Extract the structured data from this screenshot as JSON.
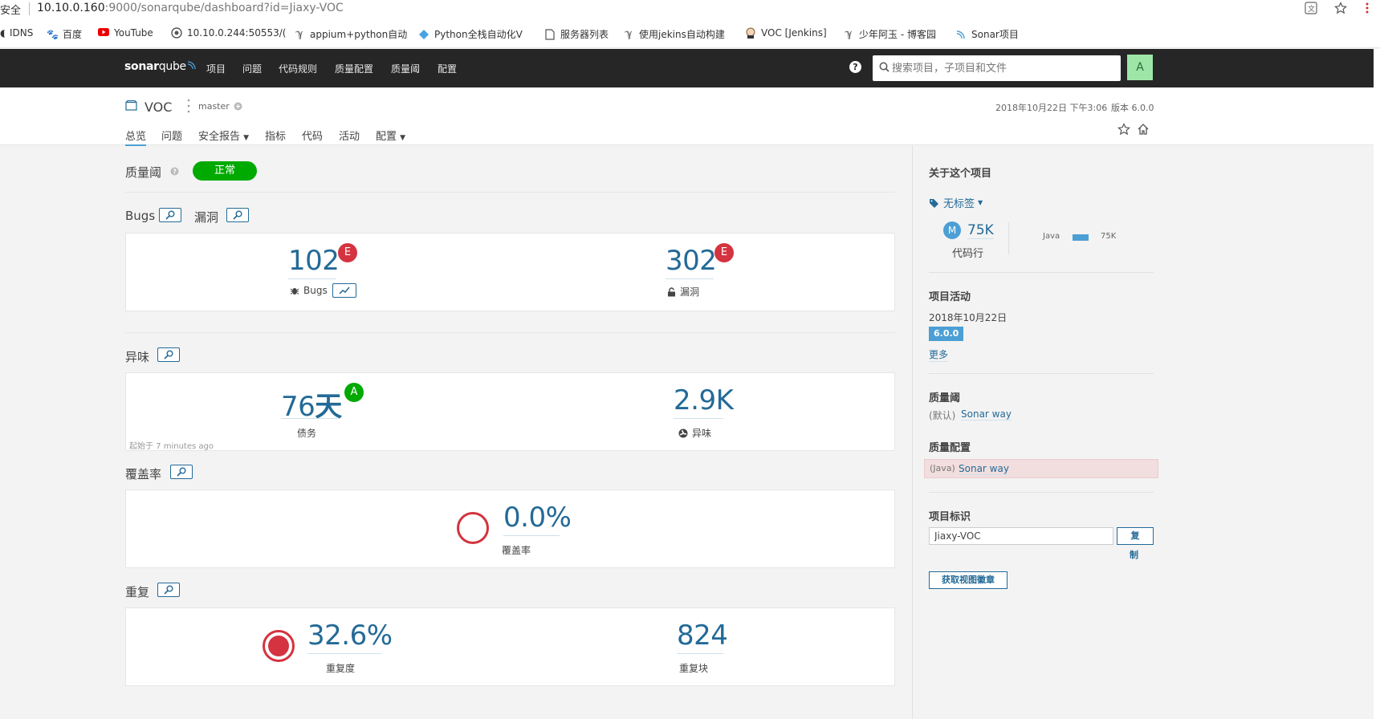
{
  "browser": {
    "security_label": "安全",
    "url_host": "10.10.0.160",
    "url_rest": ":9000/sonarqube/dashboard?id=Jiaxy-VOC",
    "bookmarks": [
      {
        "label": "IDNS",
        "icon": "globe-icon"
      },
      {
        "label": "百度",
        "icon": "baidu-icon"
      },
      {
        "label": "YouTube",
        "icon": "youtube-icon"
      },
      {
        "label": "10.10.0.244:50553/(",
        "icon": "globe-icon"
      },
      {
        "label": "appium+python自动",
        "icon": "jenkins-icon"
      },
      {
        "label": "Python全栈自动化V",
        "icon": "diamond-icon"
      },
      {
        "label": "服务器列表",
        "icon": "page-icon"
      },
      {
        "label": "使用jekins自动构建",
        "icon": "jenkins-icon"
      },
      {
        "label": "VOC [Jenkins]",
        "icon": "jenkins-butler-icon"
      },
      {
        "label": "少年阿玉 - 博客园",
        "icon": "jenkins-icon"
      },
      {
        "label": "Sonar项目",
        "icon": "sonar-icon"
      }
    ]
  },
  "nav": {
    "logo_bold": "sonar",
    "logo_light": "qube",
    "items": [
      "项目",
      "问题",
      "代码规则",
      "质量配置",
      "质量阈",
      "配置"
    ],
    "search_placeholder": "搜索项目，子项目和文件",
    "avatar_letter": "A"
  },
  "project": {
    "name": "VOC",
    "branch": "master",
    "analysis_date": "2018年10月22日 下午3:06",
    "version": "版本 6.0.0",
    "tabs": [
      "总览",
      "问题",
      "安全报告",
      "指标",
      "代码",
      "活动",
      "配置"
    ]
  },
  "quality_gate": {
    "label": "质量阈",
    "status": "正常"
  },
  "sections": {
    "bugs_title": "Bugs",
    "vuln_title": "漏洞",
    "bugs": {
      "value": "102",
      "label": "Bugs",
      "rating": "E"
    },
    "vulns": {
      "value": "302",
      "label": "漏洞",
      "rating": "E"
    },
    "smells_title": "异味",
    "debt": {
      "value": "76",
      "unit": "天",
      "label": "债务",
      "rating": "A"
    },
    "smells": {
      "value": "2.9K",
      "label": "异味"
    },
    "since": "起始于 7 minutes ago",
    "coverage_title": "覆盖率",
    "coverage": {
      "value": "0.0%",
      "label": "覆盖率"
    },
    "dup_title": "重复",
    "duplication": {
      "value": "32.6%",
      "label": "重复度"
    },
    "dup_blocks": {
      "value": "824",
      "label": "重复块"
    }
  },
  "sidebar": {
    "about_title": "关于这个项目",
    "tags": "无标签",
    "size_letter": "M",
    "loc_value": "75K",
    "loc_label": "代码行",
    "lang_name": "Java",
    "lang_value": "75K",
    "activity_title": "项目活动",
    "activity_date": "2018年10月22日",
    "activity_version": "6.0.0",
    "more": "更多",
    "qg_title": "质量阈",
    "qg_default": "(默认)",
    "qg_name": "Sonar way",
    "qp_title": "质量配置",
    "qp_lang": "(Java)",
    "qp_name": "Sonar way",
    "key_title": "项目标识",
    "key_value": "Jiaxy-VOC",
    "copy_label_1": "复",
    "copy_label_2": "制",
    "badge_button": "获取视图徽章"
  },
  "colors": {
    "nav_bg": "#262626",
    "accent": "#236a97",
    "ok_green": "#00aa00",
    "rating_e": "#d4333f",
    "rating_a": "#00aa00"
  }
}
